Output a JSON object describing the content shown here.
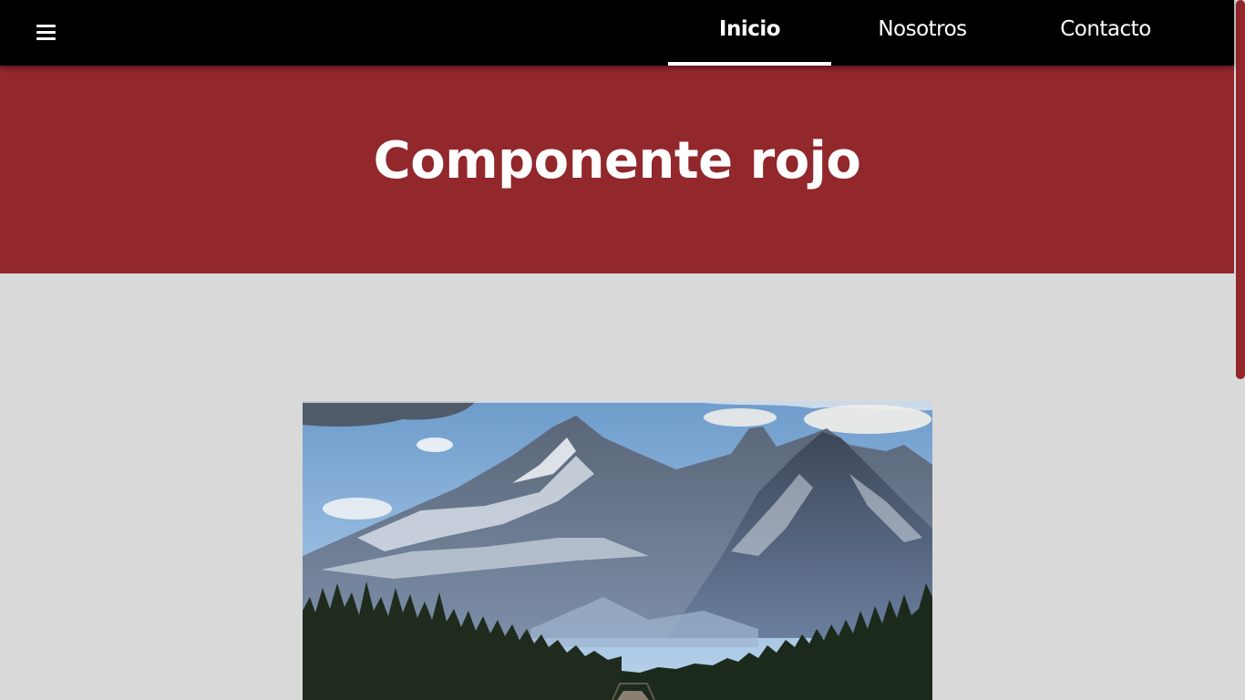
{
  "nav": {
    "menu_icon": "hamburger-menu-icon",
    "items": [
      {
        "label": "Inicio",
        "active": true
      },
      {
        "label": "Nosotros",
        "active": false
      },
      {
        "label": "Contacto",
        "active": false
      }
    ]
  },
  "hero": {
    "title": "Componente rojo"
  },
  "colors": {
    "navbar": "#000000",
    "hero": "#92272c",
    "content_bg": "#d9d9d9",
    "scrollbar": "#92272c"
  },
  "image": {
    "subject": "snow-capped mountains above a pine forest"
  }
}
